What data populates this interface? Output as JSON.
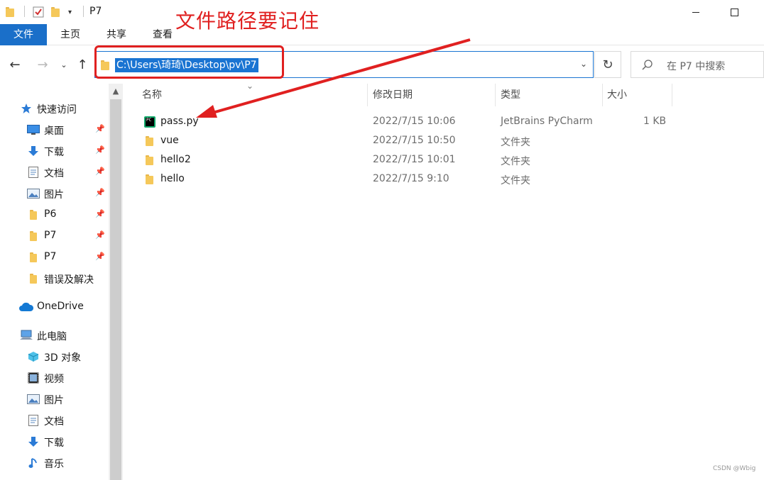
{
  "window": {
    "title": "P7"
  },
  "ribbon": {
    "tabs": [
      "文件",
      "主页",
      "共享",
      "查看"
    ]
  },
  "annotation": {
    "title": "文件路径要记住"
  },
  "address": {
    "path": "C:\\Users\\琦琦\\Desktop\\pv\\P7"
  },
  "search": {
    "placeholder": "在 P7 中搜索"
  },
  "sidebar": {
    "items": [
      {
        "label": "快速访问",
        "icon": "star-icon",
        "pinned": false
      },
      {
        "label": "桌面",
        "icon": "desktop-icon",
        "pinned": true
      },
      {
        "label": "下载",
        "icon": "download-icon",
        "pinned": true
      },
      {
        "label": "文档",
        "icon": "document-icon",
        "pinned": true
      },
      {
        "label": "图片",
        "icon": "picture-icon",
        "pinned": true
      },
      {
        "label": "P6",
        "icon": "folder-icon",
        "pinned": true
      },
      {
        "label": "P7",
        "icon": "folder-icon",
        "pinned": true
      },
      {
        "label": "P7",
        "icon": "folder-icon",
        "pinned": true
      },
      {
        "label": "错误及解决",
        "icon": "folder-icon",
        "pinned": false
      },
      {
        "label": "OneDrive",
        "icon": "cloud-icon",
        "pinned": false
      },
      {
        "label": "此电脑",
        "icon": "computer-icon",
        "pinned": false
      },
      {
        "label": "3D 对象",
        "icon": "cube-icon",
        "pinned": false
      },
      {
        "label": "视频",
        "icon": "video-icon",
        "pinned": false
      },
      {
        "label": "图片",
        "icon": "picture-icon",
        "pinned": false
      },
      {
        "label": "文档",
        "icon": "document-icon",
        "pinned": false
      },
      {
        "label": "下载",
        "icon": "download-icon",
        "pinned": false
      },
      {
        "label": "音乐",
        "icon": "music-icon",
        "pinned": false
      }
    ]
  },
  "columns": {
    "name": "名称",
    "date": "修改日期",
    "type": "类型",
    "size": "大小"
  },
  "files": [
    {
      "name": "pass.py",
      "date": "2022/7/15 10:06",
      "type": "JetBrains PyCharm",
      "size": "1 KB",
      "icon": "pycharm-icon"
    },
    {
      "name": "vue",
      "date": "2022/7/15 10:50",
      "type": "文件夹",
      "size": "",
      "icon": "folder-icon"
    },
    {
      "name": "hello2",
      "date": "2022/7/15 10:01",
      "type": "文件夹",
      "size": "",
      "icon": "folder-icon"
    },
    {
      "name": "hello",
      "date": "2022/7/15 9:10",
      "type": "文件夹",
      "size": "",
      "icon": "folder-icon"
    }
  ],
  "watermark": "CSDN @Wbig",
  "colors": {
    "accent": "#1a74d2",
    "annotation": "#e02020",
    "folder": "#f5c85a"
  }
}
